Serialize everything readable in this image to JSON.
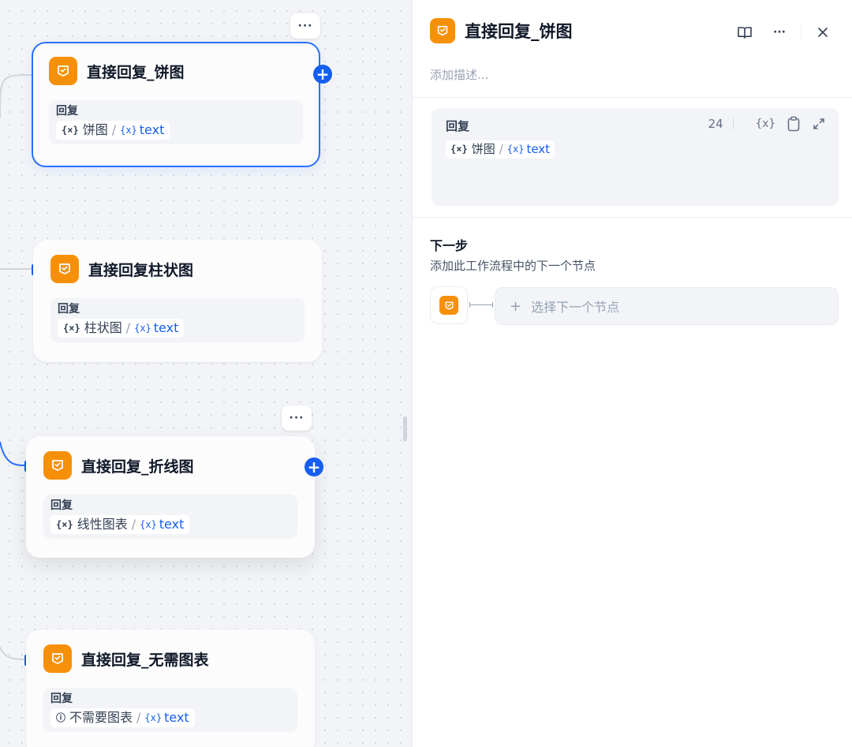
{
  "canvas": {
    "nodes": [
      {
        "title": "直接回复_饼图",
        "field_label": "回复",
        "var_icon": "{×}",
        "var_label": "饼图",
        "output_icon": "{x}",
        "output_name": "text"
      },
      {
        "title": "直接回复柱状图",
        "field_label": "回复",
        "var_icon": "{×}",
        "var_label": "柱状图",
        "output_icon": "{x}",
        "output_name": "text"
      },
      {
        "title": "直接回复_折线图",
        "field_label": "回复",
        "var_icon": "{×}",
        "var_label": "线性图表",
        "output_icon": "{x}",
        "output_name": "text"
      },
      {
        "title": "直接回复_无需图表",
        "field_label": "回复",
        "var_icon": "ⓘ",
        "var_label": "不需要图表",
        "output_icon": "{x}",
        "output_name": "text"
      }
    ],
    "more_label": "···",
    "plus_label": "+"
  },
  "panel": {
    "title": "直接回复_饼图",
    "description_placeholder": "添加描述...",
    "reply": {
      "label": "回复",
      "count": "24",
      "var_icon": "{×}",
      "var_label": "饼图",
      "output_icon": "{x}",
      "output_name": "text",
      "insert_var_label": "{x}"
    },
    "next_step": {
      "title": "下一步",
      "description": "添加此工作流程中的下一个节点",
      "select_plus": "+",
      "select_label": "选择下一个节点"
    },
    "more_label": "···"
  },
  "colors": {
    "accent": "#155eef",
    "node_icon": "#f79009",
    "selected_border": "#2970ff"
  }
}
